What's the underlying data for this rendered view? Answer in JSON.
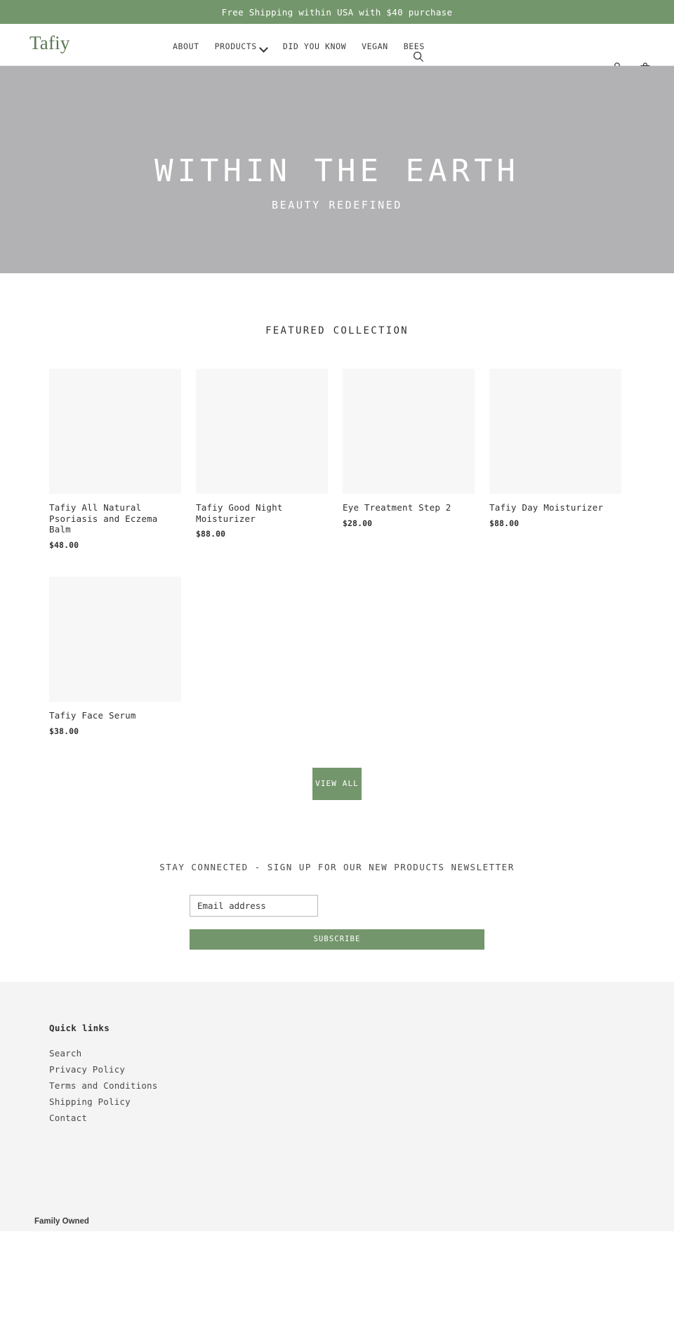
{
  "announcement": {
    "text": "Free Shipping within USA with $40 purchase"
  },
  "header": {
    "logo": "Tafiy",
    "nav": [
      {
        "label": "ABOUT",
        "has_dropdown": false
      },
      {
        "label": "PRODUCTS",
        "has_dropdown": true
      },
      {
        "label": "DID YOU KNOW",
        "has_dropdown": false
      },
      {
        "label": "VEGAN",
        "has_dropdown": false
      },
      {
        "label": "BEES",
        "has_dropdown": false
      }
    ],
    "icons": {
      "search": "search-icon",
      "account": "account-icon",
      "cart": "cart-icon"
    }
  },
  "hero": {
    "title": "WITHIN THE EARTH",
    "subtitle": "BEAUTY REDEFINED"
  },
  "featured": {
    "title": "FEATURED COLLECTION",
    "products": [
      {
        "name": "Tafiy All Natural Psoriasis and Eczema Balm",
        "price": "$48.00"
      },
      {
        "name": "Tafiy Good Night Moisturizer",
        "price": "$88.00"
      },
      {
        "name": "Eye Treatment Step 2",
        "price": "$28.00"
      },
      {
        "name": "Tafiy Day Moisturizer",
        "price": "$88.00"
      },
      {
        "name": "Tafiy Face Serum",
        "price": "$38.00"
      }
    ],
    "view_all_label": "VIEW ALL"
  },
  "newsletter": {
    "title": "STAY CONNECTED - SIGN UP FOR OUR NEW PRODUCTS NEWSLETTER",
    "email_placeholder": "Email address",
    "submit_label": "SUBSCRIBE"
  },
  "footer": {
    "heading": "Quick links",
    "links": [
      {
        "label": "Search"
      },
      {
        "label": "Privacy Policy"
      },
      {
        "label": "Terms and Conditions"
      },
      {
        "label": "Shipping Policy"
      },
      {
        "label": "Contact"
      }
    ],
    "bottom_text": "Family Owned"
  },
  "colors": {
    "brand_green": "#74966c",
    "logo_green": "#5b7a52",
    "hero_gray": "#b2b2b4",
    "placeholder_gray": "#f7f7f7",
    "footer_gray": "#f4f4f4"
  }
}
